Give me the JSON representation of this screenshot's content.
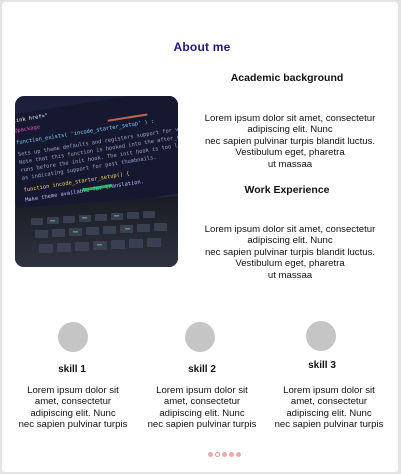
{
  "page": {
    "title": "About  me"
  },
  "sections": [
    {
      "heading": "Academic background",
      "body_lines": [
        "Lorem ipsum dolor sit amet, consectetur",
        "adipiscing elit. Nunc",
        "nec sapien pulvinar turpis blandit  luctus.",
        "Vestibulum eget, pharetra",
        "ut massaa"
      ]
    },
    {
      "heading": "Work Experience",
      "body_lines": [
        "Lorem ipsum dolor sit amet, consectetur",
        "adipiscing elit. Nunc",
        "nec sapien pulvinar turpis blandit  luctus.",
        "Vestibulum eget, pharetra",
        "ut massaa"
      ]
    }
  ],
  "photo": {
    "code_lines": [
      "link href=\"",
      "@package",
      "function_exists( 'incode_starter_setup' ) :",
      "Sets up theme defaults and registers support for various",
      "Note that this function is hooked into the after_setup",
      "runs before the init hook. The init hook is too late",
      "as indicating support for post thumbnails.",
      "function incode_starter_setup() {",
      "Make theme available for translation."
    ]
  },
  "skills": [
    {
      "title": "skill 1",
      "lines": [
        "Lorem ipsum dolor sit",
        "amet, consectetur",
        "adipiscing elit. Nunc",
        "nec sapien pulvinar turpis"
      ]
    },
    {
      "title": "skill 2",
      "lines": [
        "Lorem ipsum dolor sit",
        "amet, consectetur",
        "adipiscing elit. Nunc",
        "nec sapien pulvinar turpis"
      ]
    },
    {
      "title": "skill 3",
      "lines": [
        "Lorem ipsum dolor sit",
        "amet, consectetur",
        "adipiscing elit. Nunc",
        "nec sapien pulvinar turpis"
      ]
    }
  ],
  "pagination": {
    "count": 5,
    "active_index": 1,
    "active_color": "#e58f8f",
    "inactive_color": "#f1a9a9"
  },
  "colors": {
    "title": "#1e1a7a",
    "placeholder": "#c5c5c5"
  }
}
